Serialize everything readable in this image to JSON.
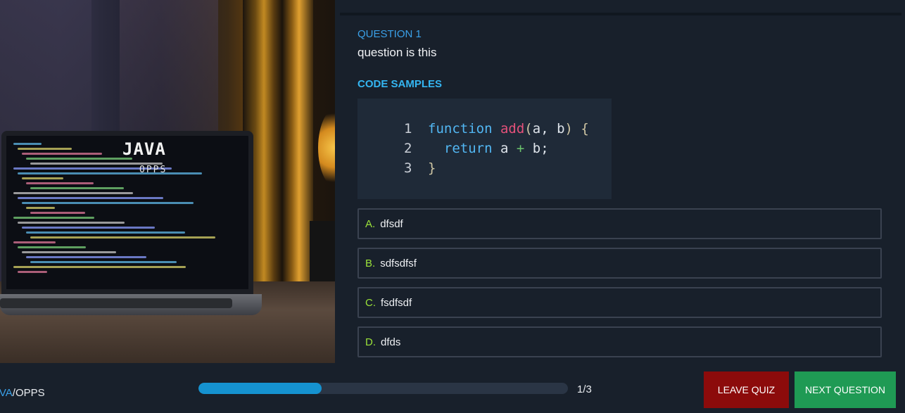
{
  "hero": {
    "title": "JAVA",
    "subtitle": "OPPS"
  },
  "question": {
    "number_label": "QUESTION 1",
    "text": "question is this",
    "code_title": "CODE SAMPLES",
    "code": {
      "language": "javascript",
      "lines": [
        {
          "num": "1",
          "content": "function add(a, b) {"
        },
        {
          "num": "2",
          "content": "  return a + b;"
        },
        {
          "num": "3",
          "content": "}"
        }
      ]
    },
    "options": [
      {
        "letter": "A.",
        "text": "dfsdf"
      },
      {
        "letter": "B.",
        "text": "sdfsdfsf"
      },
      {
        "letter": "C.",
        "text": "fsdfsdf"
      },
      {
        "letter": "D.",
        "text": "dfds"
      }
    ]
  },
  "footer": {
    "breadcrumb_category": "AVA",
    "breadcrumb_separator": "/",
    "breadcrumb_topic": "OPPS",
    "progress_fraction": 0.333,
    "progress_text": "1/3",
    "leave_label": "LEAVE QUIZ",
    "next_label": "NEXT QUESTION"
  },
  "colors": {
    "accent_blue": "#3aa0e8",
    "option_letter": "#9be23a",
    "leave_button": "#8c0b0b",
    "next_button": "#1f9a54",
    "progress_fill": "#1592d0"
  }
}
